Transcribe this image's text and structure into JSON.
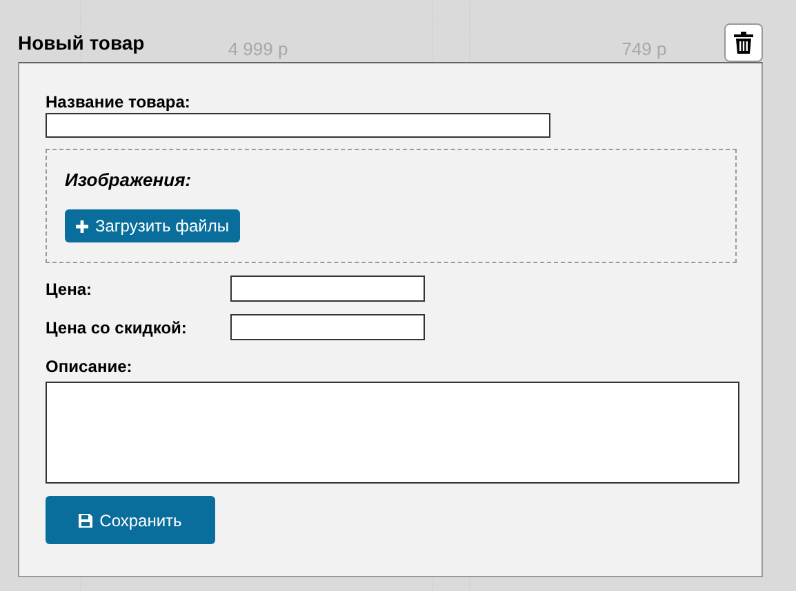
{
  "background_products": [
    {
      "price": "4 999 р"
    },
    {
      "price": "749 р"
    }
  ],
  "dialog": {
    "title": "Новый товар",
    "fields": [
      {
        "kind": "text",
        "label": "Название товара:"
      },
      {
        "kind": "images",
        "label": "Изображения:",
        "button": "Загрузить файлы"
      },
      {
        "kind": "short",
        "label": "Цена:"
      },
      {
        "kind": "short",
        "label": "Цена со скидкой:"
      },
      {
        "kind": "textarea",
        "label": "Описание:"
      }
    ],
    "save_button": "Сохранить"
  }
}
